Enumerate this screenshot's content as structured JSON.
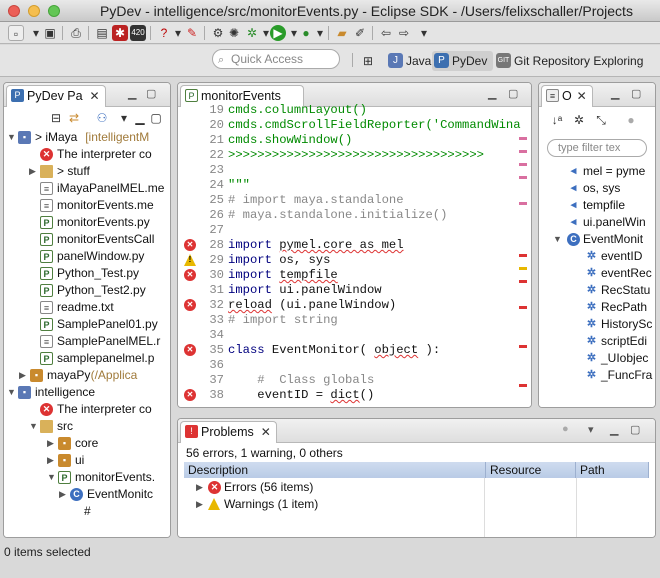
{
  "window": {
    "title": "PyDev - intelligence/src/monitorEvents.py - Eclipse SDK - /Users/felixschaller/Projects"
  },
  "perspective_bar": {
    "quick_access_placeholder": "Quick Access",
    "perspectives": [
      {
        "label": "Java",
        "icon": "java-icon"
      },
      {
        "label": "PyDev",
        "icon": "python-icon"
      },
      {
        "label": "Git Repository Exploring",
        "icon": "git-icon"
      }
    ]
  },
  "explorer": {
    "tab_label": "PyDev Pa",
    "items": [
      {
        "label": "> iMaya",
        "suffix": "[intelligentM",
        "icon": "project-icon",
        "expanded": true
      },
      {
        "label": "The interpreter co",
        "icon": "error-icon"
      },
      {
        "label": "> stuff",
        "icon": "folder-icon",
        "expanded": false
      },
      {
        "label": "iMayaPanelMEL.me",
        "icon": "file-icon"
      },
      {
        "label": "monitorEvents.me",
        "icon": "file-icon"
      },
      {
        "label": "monitorEvents.py",
        "icon": "python-file-icon"
      },
      {
        "label": "monitorEventsCall",
        "icon": "python-file-icon"
      },
      {
        "label": "panelWindow.py",
        "icon": "python-file-icon"
      },
      {
        "label": "Python_Test.py",
        "icon": "python-file-icon"
      },
      {
        "label": "Python_Test2.py",
        "icon": "python-file-icon"
      },
      {
        "label": "readme.txt",
        "icon": "file-icon"
      },
      {
        "label": "SamplePanel01.py",
        "icon": "python-file-icon"
      },
      {
        "label": "SamplePanelMEL.r",
        "icon": "file-icon"
      },
      {
        "label": "samplepanelmel.p",
        "icon": "python-file-icon"
      },
      {
        "label": "mayaPy",
        "suffix": "(/Applica",
        "icon": "package-icon",
        "expanded": false
      },
      {
        "label": "intelligence",
        "icon": "project-icon",
        "expanded": true
      },
      {
        "label": "The interpreter co",
        "icon": "error-icon"
      },
      {
        "label": "src",
        "icon": "source-folder-icon",
        "expanded": true
      },
      {
        "label": "core",
        "icon": "package-icon",
        "expanded": false
      },
      {
        "label": "ui",
        "icon": "package-icon",
        "expanded": false
      },
      {
        "label": "monitorEvents.",
        "icon": "python-file-icon",
        "expanded": true
      },
      {
        "label": "EventMonitc",
        "icon": "class-icon",
        "expanded": false
      },
      {
        "label": "#",
        "icon": ""
      }
    ]
  },
  "editor": {
    "tab_label": "monitorEvents",
    "lines": [
      {
        "n": "19",
        "marker": "",
        "segments": [
          {
            "t": "cmds.columnLayout()",
            "c": "str"
          }
        ]
      },
      {
        "n": "20",
        "marker": "",
        "segments": [
          {
            "t": "cmds.cmdScrollFieldReporter('CommandWina",
            "c": "str"
          }
        ]
      },
      {
        "n": "21",
        "marker": "",
        "segments": [
          {
            "t": "cmds.showWindow()",
            "c": "str"
          }
        ]
      },
      {
        "n": "22",
        "marker": "",
        "segments": [
          {
            "t": ">>>>>>>>>>>>>>>>>>>>>>>>>>>>>>>>>>>",
            "c": "str"
          }
        ]
      },
      {
        "n": "23",
        "marker": "",
        "segments": []
      },
      {
        "n": "24",
        "marker": "",
        "segments": [
          {
            "t": "\"\"\"",
            "c": "str"
          }
        ]
      },
      {
        "n": "25",
        "marker": "",
        "segments": [
          {
            "t": "# import maya.standalone",
            "c": "cm"
          }
        ]
      },
      {
        "n": "26",
        "marker": "",
        "segments": [
          {
            "t": "# maya.standalone.initialize()",
            "c": "cm"
          }
        ]
      },
      {
        "n": "27",
        "marker": "",
        "segments": []
      },
      {
        "n": "28",
        "marker": "error",
        "segments": [
          {
            "t": "import",
            "c": "kw"
          },
          {
            "t": " "
          },
          {
            "t": "pymel.core as mel",
            "c": "sq"
          }
        ]
      },
      {
        "n": "29",
        "marker": "warning",
        "segments": [
          {
            "t": "import",
            "c": "kw"
          },
          {
            "t": " os, sys"
          }
        ]
      },
      {
        "n": "30",
        "marker": "error",
        "segments": [
          {
            "t": "import",
            "c": "kw"
          },
          {
            "t": " "
          },
          {
            "t": "tempfile",
            "c": "sq"
          }
        ]
      },
      {
        "n": "31",
        "marker": "",
        "segments": [
          {
            "t": "import",
            "c": "kw"
          },
          {
            "t": " ui.panelWindow"
          }
        ]
      },
      {
        "n": "32",
        "marker": "error",
        "segments": [
          {
            "t": "reload",
            "c": "sq"
          },
          {
            "t": " (ui.panelWindow)"
          }
        ]
      },
      {
        "n": "33",
        "marker": "",
        "segments": [
          {
            "t": "# import string",
            "c": "cm"
          }
        ]
      },
      {
        "n": "34",
        "marker": "",
        "segments": []
      },
      {
        "n": "35",
        "marker": "error",
        "segments": [
          {
            "t": "class",
            "c": "kw"
          },
          {
            "t": " EventMonitor( "
          },
          {
            "t": "object",
            "c": "sq"
          },
          {
            "t": " ):"
          }
        ]
      },
      {
        "n": "36",
        "marker": "",
        "segments": []
      },
      {
        "n": "37",
        "marker": "",
        "segments": [
          {
            "t": "    #  Class globals",
            "c": "cm"
          }
        ]
      },
      {
        "n": "38",
        "marker": "error",
        "segments": [
          {
            "t": "    eventID = "
          },
          {
            "t": "dict",
            "c": "sq"
          },
          {
            "t": "()"
          }
        ]
      }
    ]
  },
  "outline": {
    "tab_label": "O",
    "filter_placeholder": "type filter tex",
    "items": [
      {
        "label": "mel = pyme",
        "icon": "import-icon"
      },
      {
        "label": "os, sys",
        "icon": "import-icon"
      },
      {
        "label": "tempfile",
        "icon": "import-icon"
      },
      {
        "label": "ui.panelWin",
        "icon": "import-icon"
      },
      {
        "label": "EventMonit",
        "icon": "class-icon"
      },
      {
        "label": "eventID",
        "icon": "attribute-icon"
      },
      {
        "label": "eventRec",
        "icon": "attribute-icon"
      },
      {
        "label": "RecStatu",
        "icon": "attribute-icon"
      },
      {
        "label": "RecPath",
        "icon": "attribute-icon"
      },
      {
        "label": "HistorySc",
        "icon": "attribute-icon"
      },
      {
        "label": "scriptEdi",
        "icon": "attribute-icon"
      },
      {
        "label": "_UIobjec",
        "icon": "attribute-icon"
      },
      {
        "label": "_FuncFra",
        "icon": "attribute-icon"
      }
    ]
  },
  "problems": {
    "tab_label": "Problems",
    "summary": "56 errors, 1 warning, 0 others",
    "columns": [
      "Description",
      "Resource",
      "Path"
    ],
    "groups": [
      {
        "label": "Errors (56 items)",
        "icon": "error-icon"
      },
      {
        "label": "Warnings (1 item)",
        "icon": "warning-icon"
      }
    ]
  },
  "status": {
    "text": "0 items selected"
  },
  "colors": {
    "accent": "#3d6fbf",
    "error": "#dd3333",
    "warning": "#e8b800",
    "string": "#008a00",
    "keyword": "#00007f"
  }
}
